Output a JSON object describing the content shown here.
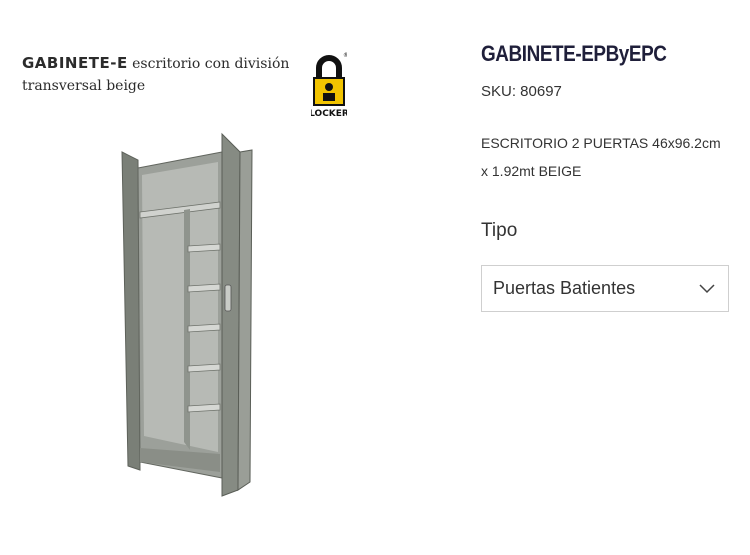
{
  "image_caption": {
    "brand": "GABINETE-E",
    "text_line1": " escritorio con división",
    "text_line2": "transversal beige"
  },
  "logo": {
    "text": "LOCKER",
    "registered": "®"
  },
  "product": {
    "title": "GABINETE-EPByEPC",
    "sku": "SKU: 80697",
    "description": "ESCRITORIO 2 PUERTAS 46x96.2cm x 1.92mt BEIGE"
  },
  "options": {
    "label": "Tipo",
    "selected": "Puertas Batientes",
    "chevron_icon": "chevron-down-icon"
  },
  "colors": {
    "title": "#1f1f3a",
    "cabinet": "#8b9088",
    "logo_yellow": "#f2c400"
  }
}
